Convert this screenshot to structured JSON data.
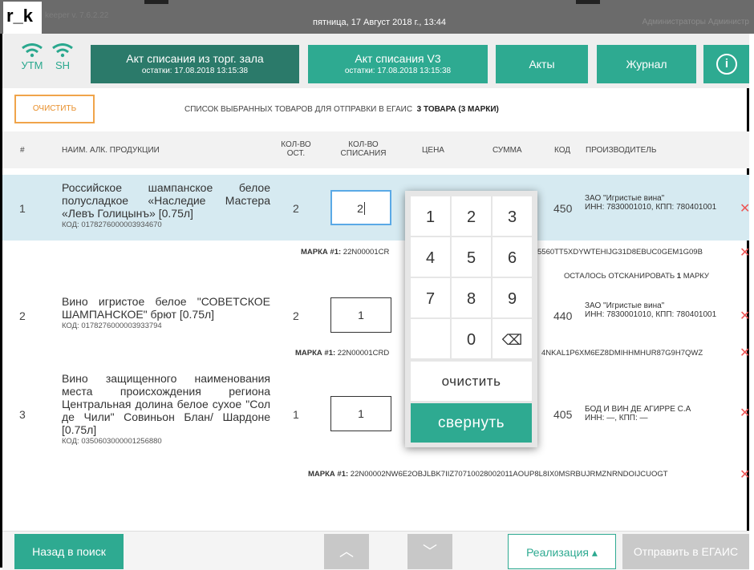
{
  "titlebar": {
    "logo": "r_k",
    "version": "keeper v. 7.6.2.22",
    "datetime": "пятница, 17 Август 2018 г., 13:44",
    "user": "Администраторы Администр"
  },
  "status": {
    "utm": "УТМ",
    "sh": "SH"
  },
  "nav": {
    "act_hall": {
      "title": "Акт списания из торг. зала",
      "sub": "остатки: 17.08.2018 13:15:38"
    },
    "act_v3": {
      "title": "Акт списания V3",
      "sub": "остатки: 17.08.2018 13:15:38"
    },
    "acts": "Акты",
    "journal": "Журнал",
    "info_glyph": "i"
  },
  "clear_button": "ОЧИСТИТЬ",
  "caption": {
    "text": "СПИСОК ВЫБРАННЫХ ТОВАРОВ ДЛЯ ОТПРАВКИ В ЕГАИС",
    "count": "3 ТОВАРА  (3 МАРКИ)"
  },
  "columns": {
    "num": "#",
    "name": "НАИМ. АЛК. ПРОДУКЦИИ",
    "rest_1": "КОЛ-ВО",
    "rest_2": "ОСТ.",
    "writeoff_1": "КОЛ-ВО",
    "writeoff_2": "СПИСАНИЯ",
    "price": "ЦЕНА",
    "sum": "СУММА",
    "code": "КОД",
    "producer": "ПРОИЗВОДИТЕЛЬ"
  },
  "rows": [
    {
      "num": "1",
      "name": "Российское шампанское белое полусладкое «Наследие Мастера «Левъ Голицынъ» [0.75л]",
      "code": "КОД: 0178276000003934670",
      "rest": "2",
      "qty": "2",
      "alc_code": "450",
      "producer_name": "ЗАО \"Игристые вина\"",
      "producer_ids": "ИНН: 7830001010, КПП: 780401001",
      "mark_label": "МАРКА #1:",
      "mark_start": "22N00001CR",
      "mark_end": "5560TT5XDYWTEHIJG31D8EBUC0GEM1G09B",
      "remain_pre": "ОСТАЛОСЬ ОТСКАНИРОВАТЬ",
      "remain_n": "1",
      "remain_post": "МАРКУ"
    },
    {
      "num": "2",
      "name": "Вино игристое белое \"СОВЕТСКОЕ ШАМПАНСКОЕ\" брют [0.75л]",
      "code": "КОД: 0178276000003933794",
      "rest": "2",
      "qty": "1",
      "alc_code": "440",
      "producer_name": "ЗАО \"Игристые вина\"",
      "producer_ids": "ИНН: 7830001010, КПП: 780401001",
      "mark_label": "МАРКА #1:",
      "mark_start": "22N00001CRD",
      "mark_end": "4NKAL1P6XM6EZ8DMIHHMHUR87G9H7QWZ"
    },
    {
      "num": "3",
      "name": "Вино защищенного наименования места происхождения региона Центральная долина белое сухое \"Сол де Чили\" Совиньон Блан/ Шардоне [0.75л]",
      "code": "КОД: 0350603000001256880",
      "rest": "1",
      "qty": "1",
      "alc_code": "405",
      "producer_name": "БОД И ВИН ДЕ АГИРРЕ С.А",
      "producer_ids": "ИНН: —, КПП: —",
      "mark_label": "МАРКА #1:",
      "mark_full": "22N00002NW6E2OBJLBK7IIZ70710028002011AOUP8L8IX0MSRBUJRMZNRNDOIJCUOGT"
    }
  ],
  "keypad": {
    "keys": [
      "1",
      "2",
      "3",
      "4",
      "5",
      "6",
      "7",
      "8",
      "9",
      "0"
    ],
    "backspace_glyph": "⌫",
    "clear": "очистить",
    "collapse": "свернуть"
  },
  "footer": {
    "back": "Назад в поиск",
    "up_glyph": "︿",
    "down_glyph": "﹀",
    "sales": "Реализация ▴",
    "send": "Отправить в ЕГАИС"
  }
}
